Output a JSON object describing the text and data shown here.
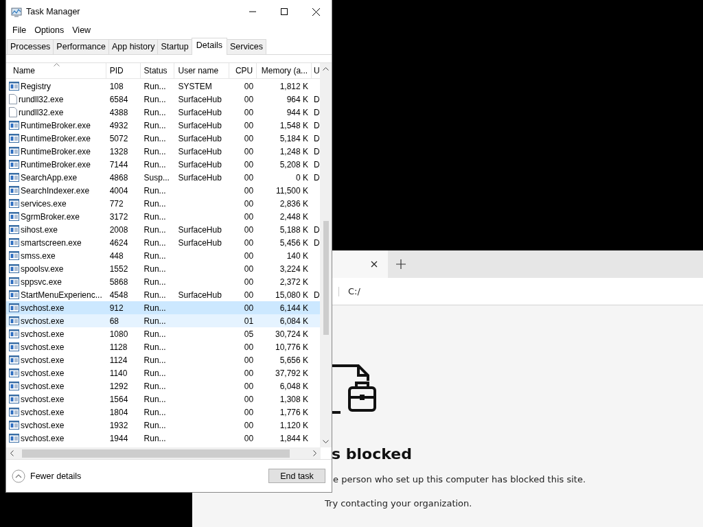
{
  "task_manager": {
    "title": "Task Manager",
    "menu": [
      "File",
      "Options",
      "View"
    ],
    "tabs": [
      {
        "label": "Processes",
        "selected": false
      },
      {
        "label": "Performance",
        "selected": false
      },
      {
        "label": "App history",
        "selected": false
      },
      {
        "label": "Startup",
        "selected": false
      },
      {
        "label": "Details",
        "selected": true
      },
      {
        "label": "Services",
        "selected": false
      }
    ],
    "columns": [
      "Name",
      "PID",
      "Status",
      "User name",
      "CPU",
      "Memory (a...",
      "U"
    ],
    "rows": [
      {
        "name": "Registry",
        "kind": "app",
        "pid": "108",
        "status": "Run...",
        "user": "SYSTEM",
        "cpu": "00",
        "memory": "1,812 K",
        "selected": false,
        "hovered": false
      },
      {
        "name": "rundll32.exe",
        "kind": "file",
        "pid": "6584",
        "status": "Run...",
        "user": "SurfaceHub",
        "cpu": "00",
        "memory": "964 K",
        "column_7": "D",
        "selected": false,
        "hovered": false
      },
      {
        "name": "rundll32.exe",
        "kind": "file",
        "pid": "4388",
        "status": "Run...",
        "user": "SurfaceHub",
        "cpu": "00",
        "memory": "944 K",
        "column_7": "D",
        "selected": false,
        "hovered": false
      },
      {
        "name": "RuntimeBroker.exe",
        "kind": "app",
        "pid": "4932",
        "status": "Run...",
        "user": "SurfaceHub",
        "cpu": "00",
        "memory": "1,548 K",
        "column_7": "D",
        "selected": false,
        "hovered": false
      },
      {
        "name": "RuntimeBroker.exe",
        "kind": "app",
        "pid": "5072",
        "status": "Run...",
        "user": "SurfaceHub",
        "cpu": "00",
        "memory": "5,184 K",
        "column_7": "D",
        "selected": false,
        "hovered": false
      },
      {
        "name": "RuntimeBroker.exe",
        "kind": "app",
        "pid": "1328",
        "status": "Run...",
        "user": "SurfaceHub",
        "cpu": "00",
        "memory": "1,248 K",
        "column_7": "D",
        "selected": false,
        "hovered": false
      },
      {
        "name": "RuntimeBroker.exe",
        "kind": "app",
        "pid": "7144",
        "status": "Run...",
        "user": "SurfaceHub",
        "cpu": "00",
        "memory": "5,208 K",
        "column_7": "D",
        "selected": false,
        "hovered": false
      },
      {
        "name": "SearchApp.exe",
        "kind": "app",
        "pid": "4868",
        "status": "Susp...",
        "user": "SurfaceHub",
        "cpu": "00",
        "memory": "0 K",
        "column_7": "D",
        "selected": false,
        "hovered": false
      },
      {
        "name": "SearchIndexer.exe",
        "kind": "app",
        "pid": "4004",
        "status": "Run...",
        "cpu": "00",
        "memory": "11,500 K",
        "selected": false,
        "hovered": false
      },
      {
        "name": "services.exe",
        "kind": "app",
        "pid": "772",
        "status": "Run...",
        "cpu": "00",
        "memory": "2,836 K",
        "selected": false,
        "hovered": false
      },
      {
        "name": "SgrmBroker.exe",
        "kind": "app",
        "pid": "3172",
        "status": "Run...",
        "cpu": "00",
        "memory": "2,448 K",
        "selected": false,
        "hovered": false
      },
      {
        "name": "sihost.exe",
        "kind": "app",
        "pid": "2008",
        "status": "Run...",
        "user": "SurfaceHub",
        "cpu": "00",
        "memory": "5,188 K",
        "column_7": "D",
        "selected": false,
        "hovered": false
      },
      {
        "name": "smartscreen.exe",
        "kind": "app",
        "pid": "4624",
        "status": "Run...",
        "user": "SurfaceHub",
        "cpu": "00",
        "memory": "5,456 K",
        "column_7": "D",
        "selected": false,
        "hovered": false
      },
      {
        "name": "smss.exe",
        "kind": "app",
        "pid": "448",
        "status": "Run...",
        "cpu": "00",
        "memory": "140 K",
        "selected": false,
        "hovered": false
      },
      {
        "name": "spoolsv.exe",
        "kind": "app",
        "pid": "1552",
        "status": "Run...",
        "cpu": "00",
        "memory": "3,224 K",
        "selected": false,
        "hovered": false
      },
      {
        "name": "sppsvc.exe",
        "kind": "app",
        "pid": "5868",
        "status": "Run...",
        "cpu": "00",
        "memory": "2,372 K",
        "selected": false,
        "hovered": false
      },
      {
        "name": "StartMenuExperienc...",
        "kind": "app",
        "pid": "4548",
        "status": "Run...",
        "user": "SurfaceHub",
        "cpu": "00",
        "memory": "15,080 K",
        "column_7": "D",
        "selected": false,
        "hovered": false
      },
      {
        "name": "svchost.exe",
        "kind": "app",
        "pid": "912",
        "status": "Run...",
        "cpu": "00",
        "memory": "6,144 K",
        "selected": true,
        "hovered": false
      },
      {
        "name": "svchost.exe",
        "kind": "app",
        "pid": "68",
        "status": "Run...",
        "cpu": "01",
        "memory": "6,084 K",
        "selected": false,
        "hovered": true
      },
      {
        "name": "svchost.exe",
        "kind": "app",
        "pid": "1080",
        "status": "Run...",
        "cpu": "05",
        "memory": "30,724 K",
        "selected": false,
        "hovered": false
      },
      {
        "name": "svchost.exe",
        "kind": "app",
        "pid": "1128",
        "status": "Run...",
        "cpu": "00",
        "memory": "10,776 K",
        "selected": false,
        "hovered": false
      },
      {
        "name": "svchost.exe",
        "kind": "app",
        "pid": "1124",
        "status": "Run...",
        "cpu": "00",
        "memory": "5,656 K",
        "selected": false,
        "hovered": false
      },
      {
        "name": "svchost.exe",
        "kind": "app",
        "pid": "1140",
        "status": "Run...",
        "cpu": "00",
        "memory": "37,792 K",
        "selected": false,
        "hovered": false
      },
      {
        "name": "svchost.exe",
        "kind": "app",
        "pid": "1292",
        "status": "Run...",
        "cpu": "00",
        "memory": "6,048 K",
        "selected": false,
        "hovered": false
      },
      {
        "name": "svchost.exe",
        "kind": "app",
        "pid": "1564",
        "status": "Run...",
        "cpu": "00",
        "memory": "1,308 K",
        "selected": false,
        "hovered": false
      },
      {
        "name": "svchost.exe",
        "kind": "app",
        "pid": "1804",
        "status": "Run...",
        "cpu": "00",
        "memory": "1,776 K",
        "selected": false,
        "hovered": false
      },
      {
        "name": "svchost.exe",
        "kind": "app",
        "pid": "1932",
        "status": "Run...",
        "cpu": "00",
        "memory": "1,120 K",
        "selected": false,
        "hovered": false
      },
      {
        "name": "svchost.exe",
        "kind": "app",
        "pid": "1944",
        "status": "Run...",
        "cpu": "00",
        "memory": "1,844 K",
        "selected": false,
        "hovered": false
      }
    ],
    "fewer_details": "Fewer details",
    "end_task": "End task"
  },
  "browser": {
    "address": "C:/",
    "heading": "s blocked",
    "message": "e person who set up this computer has blocked this site.",
    "hint": "Try contacting your organization."
  }
}
